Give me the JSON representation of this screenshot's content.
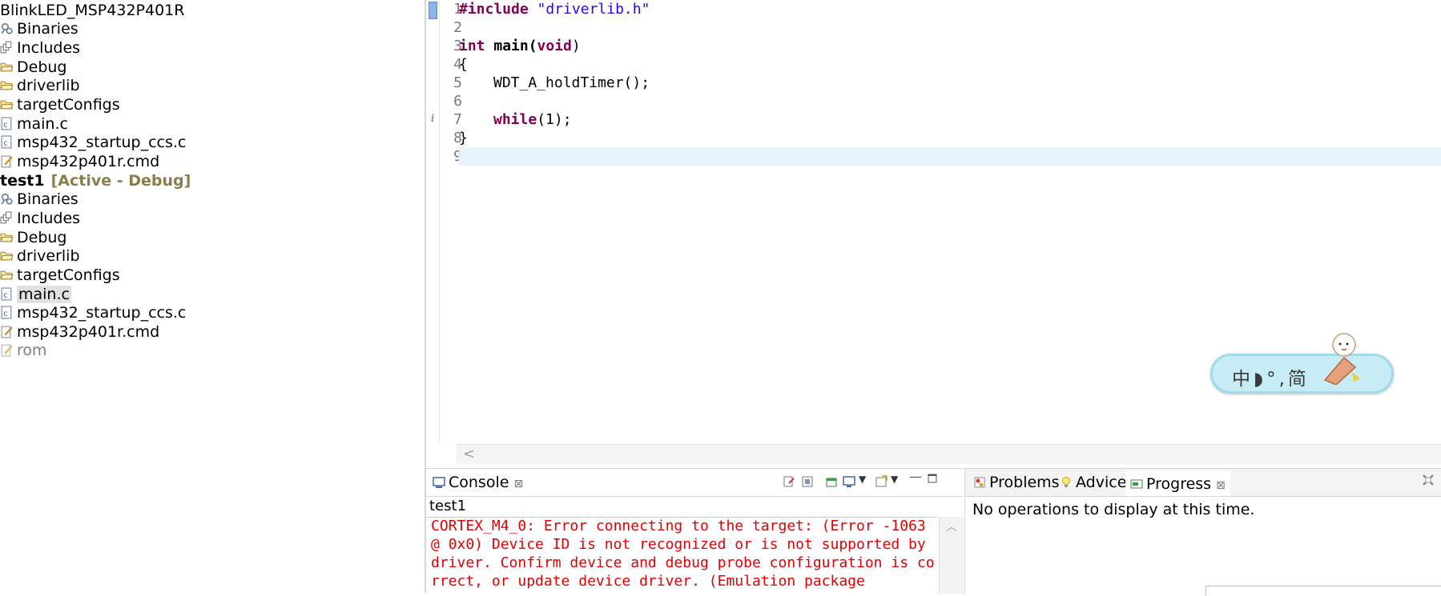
{
  "explorer": {
    "projects": [
      {
        "name": "BlinkLED_MSP432P401R",
        "children": [
          "Binaries",
          "Includes",
          "Debug",
          "driverlib",
          "targetConfigs",
          "main.c",
          "msp432_startup_ccs.c",
          "msp432p401r.cmd"
        ]
      },
      {
        "name": "test1",
        "tag": "[Active - Debug]",
        "children": [
          "Binaries",
          "Includes",
          "Debug",
          "driverlib",
          "targetConfigs",
          "main.c",
          "msp432_startup_ccs.c",
          "msp432p401r.cmd",
          "rom"
        ]
      }
    ]
  },
  "editor": {
    "line_numbers": [
      "1",
      "2",
      "3",
      "4",
      "5",
      "6",
      "7",
      "8",
      "9"
    ],
    "code": {
      "l1_kw": "#include",
      "l1_str": "\"driverlib.h\"",
      "l3_kw1": "int",
      "l3_name": "main(",
      "l3_kw2": "void",
      "l3_end": ")",
      "l4": "{",
      "l5": "WDT_A_holdTimer();",
      "l7_kw": "while",
      "l7_end": "(1);",
      "l8": "}"
    },
    "hscroll_left": "<"
  },
  "ime": {
    "text": "中◗°,简"
  },
  "console": {
    "tab_label": "Console",
    "tab_close": "⊠",
    "session": "test1",
    "error_text": "CORTEX_M4_0: Error connecting to the target: (Error -1063 @ 0x0) Device ID is not recognized or is not supported by driver. Confirm device and debug probe configuration is correct, or update device driver. (Emulation package"
  },
  "right_panel": {
    "tabs": [
      {
        "label": "Problems"
      },
      {
        "label": "Advice"
      },
      {
        "label": "Progress",
        "close": "⊠"
      }
    ],
    "message": "No operations to display at this time."
  },
  "colors": {
    "keyword": "#7f0055",
    "string": "#2a00ff",
    "error": "#e30000",
    "active_tag": "#8b7d4b"
  }
}
